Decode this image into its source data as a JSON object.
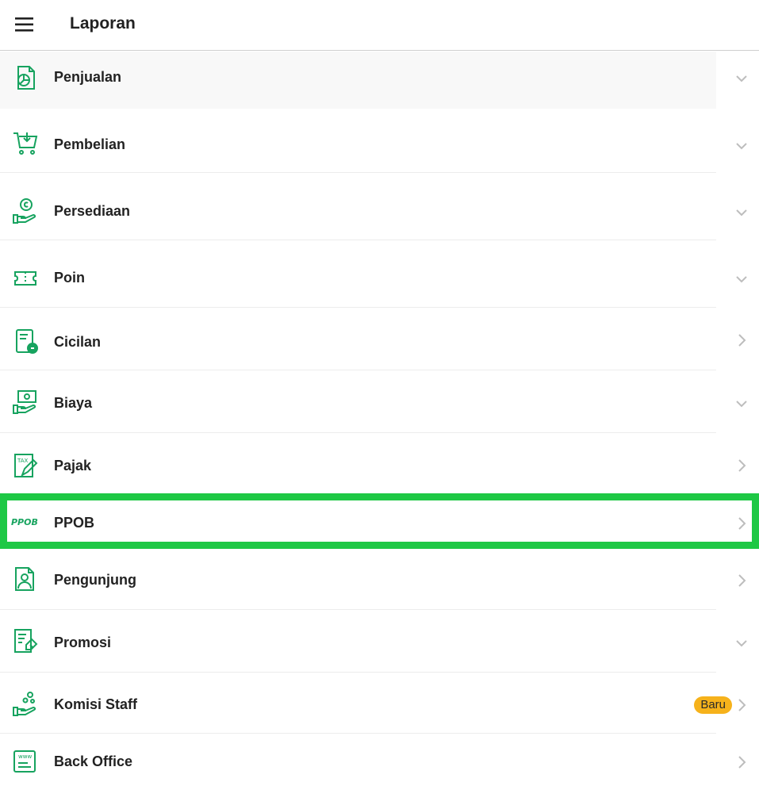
{
  "header": {
    "title": "Laporan",
    "menu_icon": "hamburger-menu-icon"
  },
  "colors": {
    "icon_green": "#17a35f",
    "badge": "#f6b21b",
    "highlight": "#1ec845",
    "chevron": "#bdbdbd"
  },
  "menu": {
    "items": [
      {
        "label": "Penjualan",
        "icon": "sales-report-icon",
        "chevron": "down"
      },
      {
        "label": "Pembelian",
        "icon": "cart-purchase-icon",
        "chevron": "down"
      },
      {
        "label": "Persediaan",
        "icon": "inventory-hand-icon",
        "chevron": "down"
      },
      {
        "label": "Poin",
        "icon": "ticket-points-icon",
        "chevron": "down"
      },
      {
        "label": "Cicilan",
        "icon": "installment-document-icon",
        "chevron": "right"
      },
      {
        "label": "Biaya",
        "icon": "cost-money-hand-icon",
        "chevron": "down"
      },
      {
        "label": "Pajak",
        "icon": "tax-document-icon",
        "chevron": "right",
        "icon_text": "TAX"
      },
      {
        "label": "PPOB",
        "icon": "ppob-text-icon",
        "chevron": "right",
        "icon_text": "PPOB",
        "highlighted": true
      },
      {
        "label": "Pengunjung",
        "icon": "visitor-document-icon",
        "chevron": "right"
      },
      {
        "label": "Promosi",
        "icon": "promotion-document-icon",
        "chevron": "down"
      },
      {
        "label": "Komisi Staff",
        "icon": "commission-hand-icon",
        "chevron": "right",
        "badge": "Baru"
      },
      {
        "label": "Back Office",
        "icon": "back-office-icon",
        "chevron": "right",
        "icon_text": "www"
      }
    ]
  }
}
